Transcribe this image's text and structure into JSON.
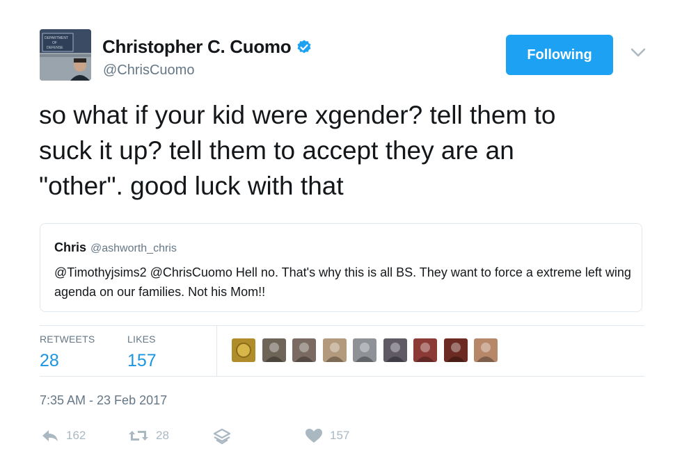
{
  "author": {
    "name": "Christopher C. Cuomo",
    "handle": "@ChrisCuomo",
    "verified": true,
    "avatar_sign_text": "DEPARTMENT OF DEFENSE"
  },
  "follow_button": {
    "label": "Following",
    "color": "#1da1f2"
  },
  "tweet": {
    "text": "so what if your kid were xgender? tell them to\nsuck it up? tell them to accept they are an\n\"other\". good luck with that"
  },
  "quoted_tweet": {
    "name": "Chris",
    "handle": "@ashworth_chris",
    "text": "@Timothyjsims2 @ChrisCuomo Hell no. That's why this is all BS. They want to force a extreme left wing agenda on our families. Not his Mom!!"
  },
  "stats": {
    "retweets": {
      "label": "RETWEETS",
      "value": "28"
    },
    "likes": {
      "label": "LIKES",
      "value": "157"
    }
  },
  "likers": [
    {
      "icon": "avatar-gold-emblem-icon",
      "color": "#b08d2a"
    },
    {
      "icon": "avatar-cat-icon",
      "color": "#6e6558"
    },
    {
      "icon": "avatar-person-icon",
      "color": "#7a6a62"
    },
    {
      "icon": "avatar-dog-icon",
      "color": "#b39a7c"
    },
    {
      "icon": "avatar-person-icon",
      "color": "#8e9196"
    },
    {
      "icon": "avatar-person-icon",
      "color": "#5f5a66"
    },
    {
      "icon": "avatar-person-icon",
      "color": "#8b3a35"
    },
    {
      "icon": "avatar-person-icon",
      "color": "#6b2b22"
    },
    {
      "icon": "avatar-person-icon",
      "color": "#b7876a"
    }
  ],
  "timestamp": "7:35 AM - 23 Feb 2017",
  "actions": {
    "reply": {
      "icon": "reply-icon",
      "count": "162"
    },
    "retweet": {
      "icon": "retweet-icon",
      "count": "28"
    },
    "stack": {
      "icon": "layers-icon"
    },
    "like": {
      "icon": "heart-icon",
      "count": "157"
    }
  },
  "colors": {
    "accent_blue": "#1da1f2",
    "stat_blue": "#1b95e0",
    "secondary_text": "#657786",
    "icon_gray": "#aab8c2",
    "border": "#e1e8ed"
  }
}
